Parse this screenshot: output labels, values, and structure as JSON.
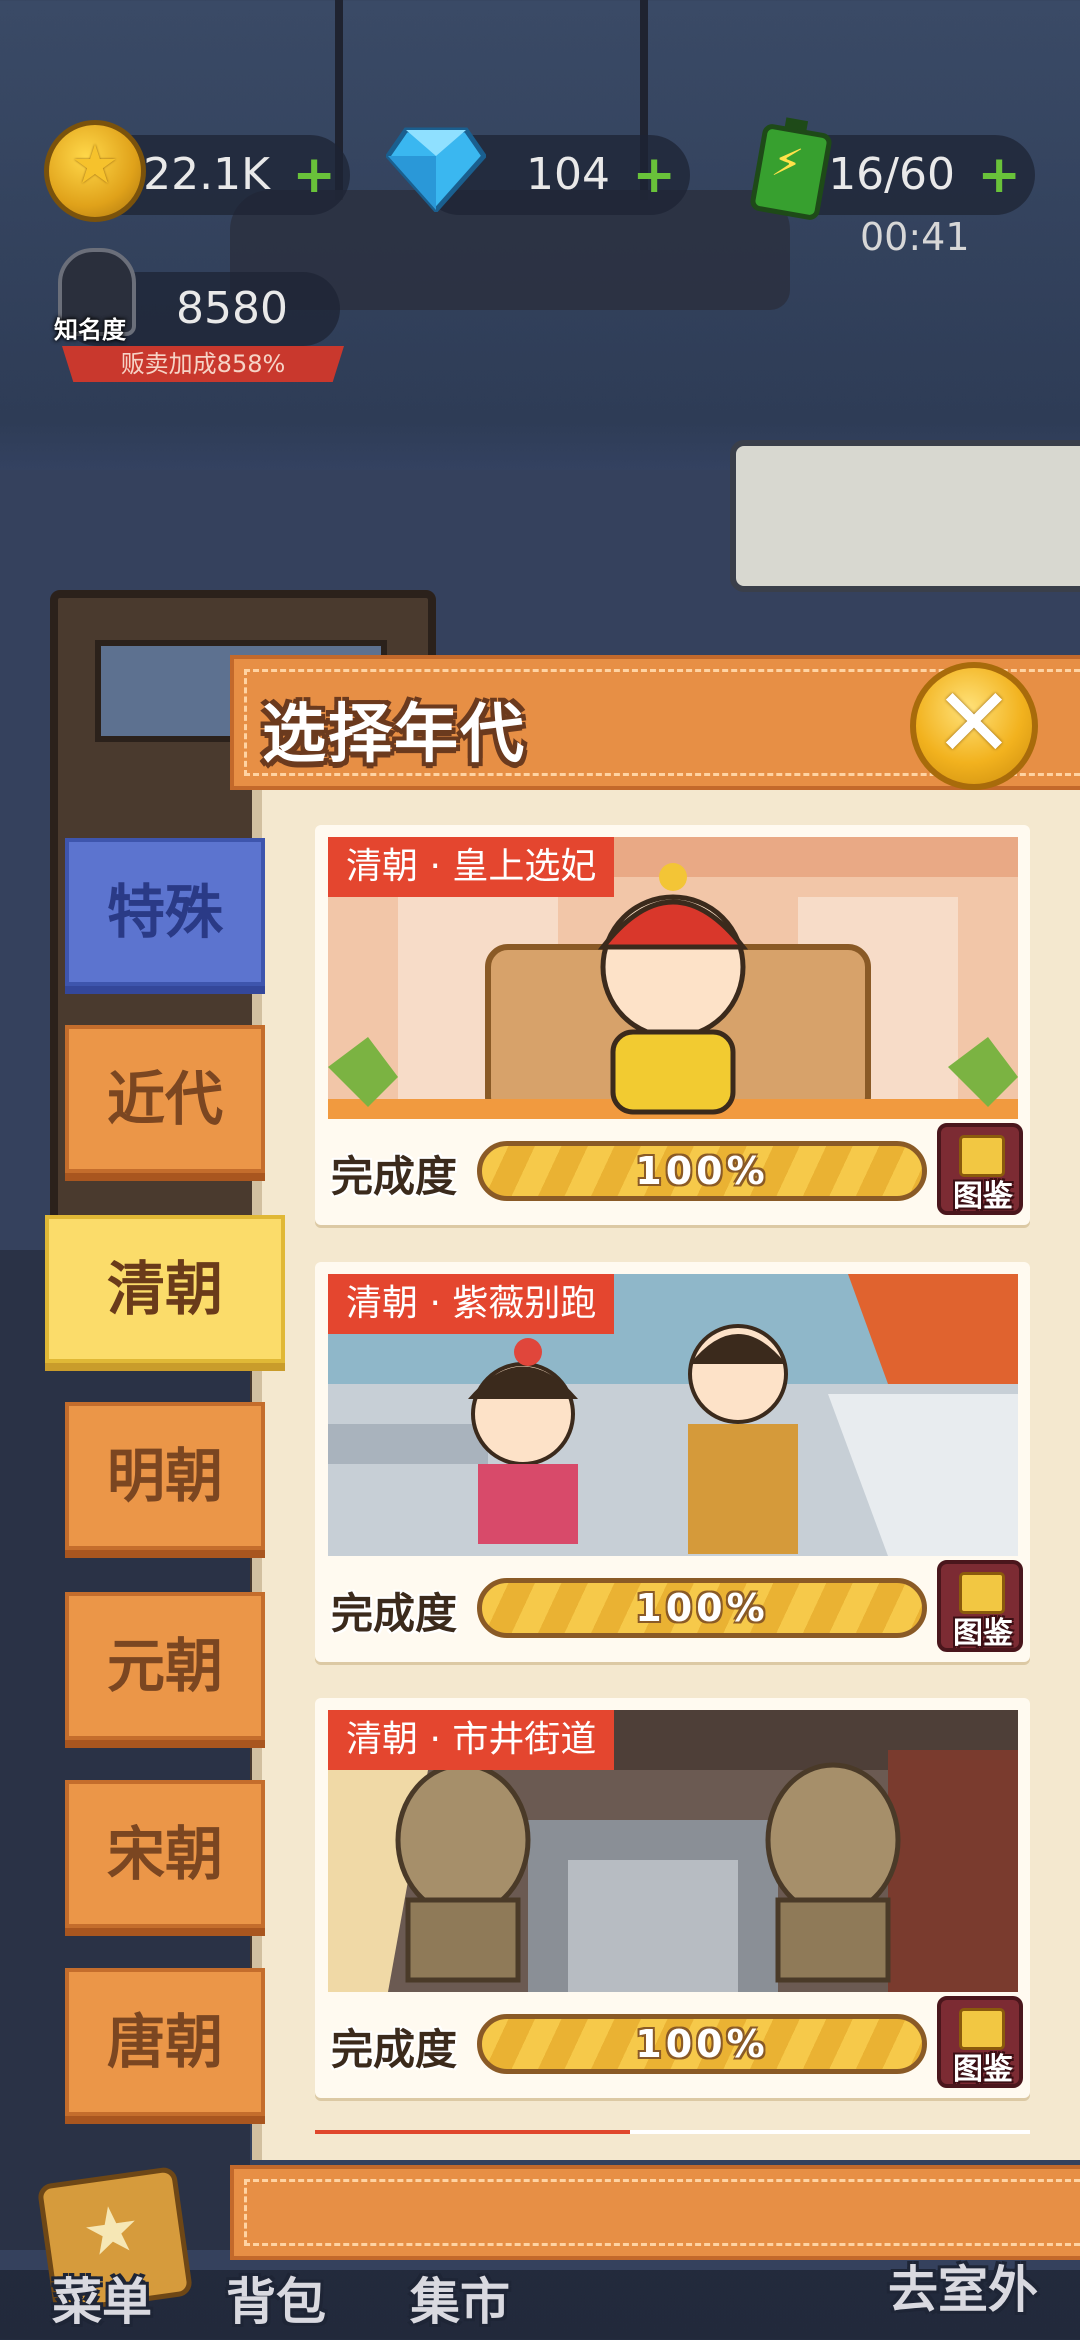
{
  "resources": {
    "coins": {
      "value": "22.1K",
      "plus": "+"
    },
    "gems": {
      "value": "104",
      "plus": "+"
    },
    "energy": {
      "value": "16/60",
      "plus": "+",
      "timer": "00:41"
    }
  },
  "fame": {
    "label": "知名度",
    "value": "8580",
    "bonus": "贩卖加成858%"
  },
  "panel": {
    "title": "选择年代",
    "close_label": "✕"
  },
  "tabs": [
    {
      "label": "特殊"
    },
    {
      "label": "近代"
    },
    {
      "label": "清朝"
    },
    {
      "label": "明朝"
    },
    {
      "label": "元朝"
    },
    {
      "label": "宋朝"
    },
    {
      "label": "唐朝"
    }
  ],
  "active_tab": "清朝",
  "levels": [
    {
      "title": "清朝 · 皇上选妃",
      "progress_label": "完成度",
      "progress": "100%",
      "book_label": "图鉴"
    },
    {
      "title": "清朝 · 紫薇别跑",
      "progress_label": "完成度",
      "progress": "100%",
      "book_label": "图鉴"
    },
    {
      "title": "清朝 · 市井街道",
      "progress_label": "完成度",
      "progress": "100%",
      "book_label": "图鉴"
    }
  ],
  "nav": {
    "menu": "菜单",
    "bag": "背包",
    "market": "集市",
    "outdoor": "去室外"
  },
  "icons": {
    "coin": "coin-icon",
    "gem": "gem-icon",
    "energy": "battery-icon",
    "close": "close-icon",
    "book": "book-icon"
  },
  "colors": {
    "accent": "#e78f45",
    "tag": "#e4462f",
    "active_tab": "#fbdc6a",
    "special_tab": "#5c74cf"
  }
}
